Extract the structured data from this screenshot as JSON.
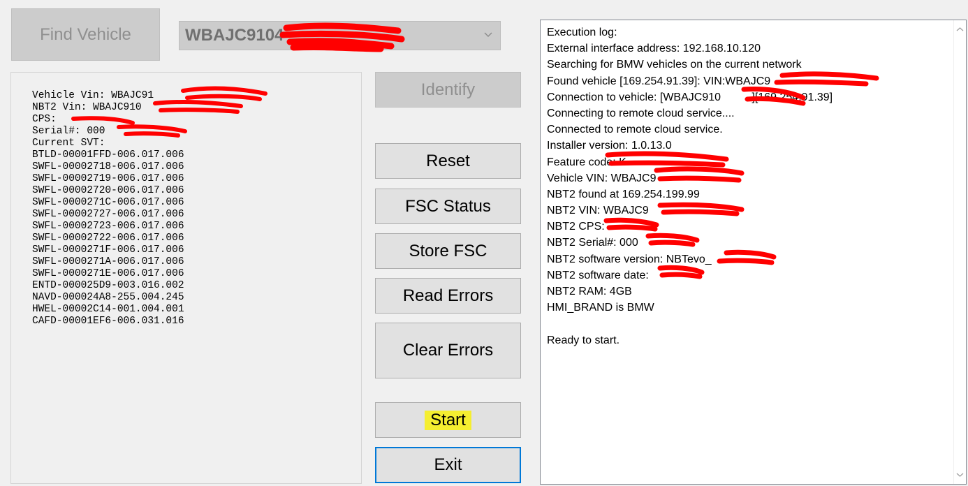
{
  "buttons": {
    "find_vehicle": "Find Vehicle",
    "identify": "Identify",
    "reset": "Reset",
    "fsc_status": "FSC Status",
    "store_fsc": "Store FSC",
    "read_errors": "Read Errors",
    "clear_errors": "Clear Errors",
    "start": "Start",
    "exit": "Exit"
  },
  "vin_select": {
    "value": "WBAJC9104"
  },
  "vehicle_info": {
    "lines": [
      "Vehicle Vin: WBAJC91",
      "NBT2 Vin: WBAJC910",
      "CPS: ",
      "Serial#: 000",
      "Current SVT:",
      "BTLD-00001FFD-006.017.006",
      "SWFL-00002718-006.017.006",
      "SWFL-00002719-006.017.006",
      "SWFL-00002720-006.017.006",
      "SWFL-0000271C-006.017.006",
      "SWFL-00002727-006.017.006",
      "SWFL-00002723-006.017.006",
      "SWFL-00002722-006.017.006",
      "SWFL-0000271F-006.017.006",
      "SWFL-0000271A-006.017.006",
      "SWFL-0000271E-006.017.006",
      "ENTD-000025D9-003.016.002",
      "NAVD-000024A8-255.004.245",
      "HWEL-00002C14-001.004.001",
      "CAFD-00001EF6-006.031.016"
    ]
  },
  "execution_log": {
    "lines": [
      "Execution log:",
      "External interface address: 192.168.10.120",
      "Searching for BMW vehicles on the current network",
      "Found vehicle [169.254.91.39]: VIN:WBAJC9",
      "Connection to vehicle: [WBAJC910          ][169.254.91.39]",
      "Connecting to remote cloud service....",
      "Connected to remote cloud service.",
      "Installer version: 1.0.13.0",
      "Feature code: K",
      "Vehicle VIN: WBAJC9",
      "NBT2 found at 169.254.199.99",
      "NBT2 VIN: WBAJC9",
      "NBT2 CPS:",
      "NBT2 Serial#: 000",
      "NBT2 software version: NBTevo_",
      "NBT2 software date:",
      "NBT2 RAM: 4GB",
      "HMI_BRAND is BMW",
      "",
      "Ready to start."
    ]
  },
  "colors": {
    "highlight": "#f5ee30",
    "redaction": "#ff0000",
    "focus_border": "#0078d7"
  },
  "icons": {
    "dropdown": "chevron-down-icon",
    "scroll_up": "scroll-up-arrow-icon",
    "scroll_down": "scroll-down-arrow-icon"
  }
}
